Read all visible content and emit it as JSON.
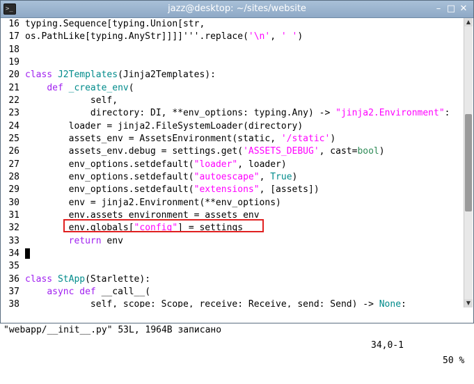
{
  "window": {
    "title": "jazz@desktop: ~/sites/website",
    "app_icon_text": ">_"
  },
  "colors": {
    "keyword": "#a020f0",
    "string": "#ff00ff",
    "type": "#2e8b57",
    "function": "#008b8b",
    "highlight_box": "#e02020"
  },
  "editor": {
    "lines": [
      {
        "no": "16",
        "segs": [
          [
            "",
            "typing.Sequence[typing.Union[str,"
          ]
        ]
      },
      {
        "no": "17",
        "segs": [
          [
            "",
            "os.PathLike[typing.AnyStr]]]]'''.replace("
          ],
          [
            "str",
            "'\\n'"
          ],
          [
            "",
            ", "
          ],
          [
            "str",
            "' '"
          ],
          [
            "",
            ")"
          ]
        ]
      },
      {
        "no": "18",
        "segs": []
      },
      {
        "no": "19",
        "segs": []
      },
      {
        "no": "20",
        "segs": [
          [
            "kw",
            "class"
          ],
          [
            "",
            " "
          ],
          [
            "fn",
            "J2Templates"
          ],
          [
            "",
            "(Jinja2Templates):"
          ]
        ]
      },
      {
        "no": "21",
        "segs": [
          [
            "",
            "    "
          ],
          [
            "kw",
            "def"
          ],
          [
            "",
            " "
          ],
          [
            "fn",
            "_create_env"
          ],
          [
            "",
            "("
          ]
        ]
      },
      {
        "no": "22",
        "segs": [
          [
            "",
            "            self,"
          ]
        ]
      },
      {
        "no": "23",
        "segs": [
          [
            "",
            "            directory: DI, **env_options: typing.Any) -> "
          ],
          [
            "str",
            "\"jinja2.Environment\""
          ],
          [
            "",
            ":"
          ]
        ]
      },
      {
        "no": "24",
        "segs": [
          [
            "",
            "        loader = jinja2.FileSystemLoader(directory)"
          ]
        ]
      },
      {
        "no": "25",
        "segs": [
          [
            "",
            "        assets_env = AssetsEnvironment(static, "
          ],
          [
            "str",
            "'/static'"
          ],
          [
            "",
            ")"
          ]
        ]
      },
      {
        "no": "26",
        "segs": [
          [
            "",
            "        assets_env.debug = settings.get("
          ],
          [
            "str",
            "'ASSETS_DEBUG'"
          ],
          [
            "",
            ", cast="
          ],
          [
            "ty",
            "bool"
          ],
          [
            "",
            ")"
          ]
        ]
      },
      {
        "no": "27",
        "segs": [
          [
            "",
            "        env_options.setdefault("
          ],
          [
            "str",
            "\"loader\""
          ],
          [
            "",
            ", loader)"
          ]
        ]
      },
      {
        "no": "28",
        "segs": [
          [
            "",
            "        env_options.setdefault("
          ],
          [
            "str",
            "\"autoescape\""
          ],
          [
            "",
            ", "
          ],
          [
            "fn",
            "True"
          ],
          [
            "",
            ")"
          ]
        ]
      },
      {
        "no": "29",
        "segs": [
          [
            "",
            "        env_options.setdefault("
          ],
          [
            "str",
            "\"extensions\""
          ],
          [
            "",
            ", [assets])"
          ]
        ]
      },
      {
        "no": "30",
        "segs": [
          [
            "",
            "        env = jinja2.Environment(**env_options)"
          ]
        ]
      },
      {
        "no": "31",
        "segs": [
          [
            "",
            "        env.assets_environment = assets_env"
          ]
        ]
      },
      {
        "no": "32",
        "segs": [
          [
            "",
            "        env.globals["
          ],
          [
            "str",
            "\"config\""
          ],
          [
            "",
            "] = settings"
          ]
        ]
      },
      {
        "no": "33",
        "segs": [
          [
            "",
            "        "
          ],
          [
            "kw",
            "return"
          ],
          [
            "",
            " env"
          ]
        ]
      },
      {
        "no": "34",
        "segs": [],
        "cursor": true
      },
      {
        "no": "35",
        "segs": []
      },
      {
        "no": "36",
        "segs": [
          [
            "kw",
            "class"
          ],
          [
            "",
            " "
          ],
          [
            "fn",
            "StApp"
          ],
          [
            "",
            "(Starlette):"
          ]
        ]
      },
      {
        "no": "37",
        "segs": [
          [
            "",
            "    "
          ],
          [
            "kw",
            "async"
          ],
          [
            "",
            " "
          ],
          [
            "kw",
            "def"
          ],
          [
            "",
            " __call__("
          ]
        ]
      },
      {
        "no": "38",
        "segs": [
          [
            "",
            "            self, scope: Scope, receive: Receive, send: Send) -> "
          ],
          [
            "fn",
            "None"
          ],
          [
            "",
            ":"
          ]
        ]
      }
    ]
  },
  "scrollbar": {
    "position_fraction": 0.5,
    "up_arrow": "▲",
    "down_arrow": "▼"
  },
  "statusbar": {
    "message": "\"webapp/__init__.py\" 53L, 1964B записано",
    "cursor_position": "34,0-1",
    "scroll_percent": "50 %"
  }
}
